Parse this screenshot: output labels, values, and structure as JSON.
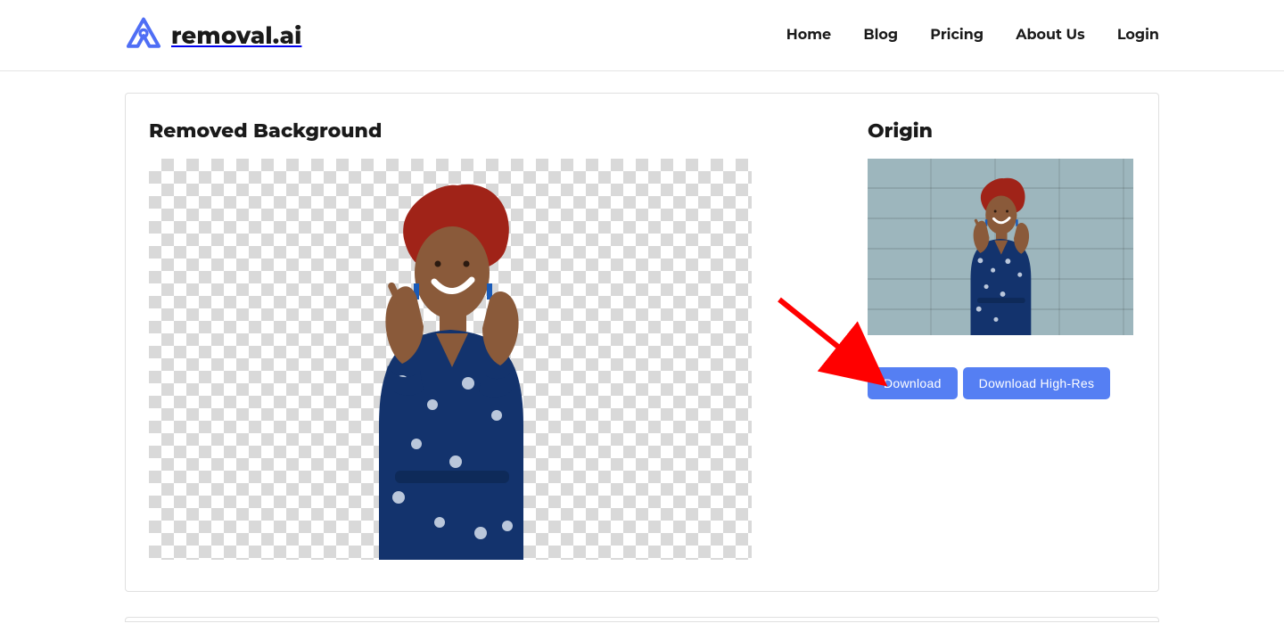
{
  "brand": {
    "name": "removal.ai",
    "accent": "#4f6ef5"
  },
  "nav": {
    "home": "Home",
    "blog": "Blog",
    "pricing": "Pricing",
    "about": "About Us",
    "login": "Login"
  },
  "result": {
    "heading": "Removed Background",
    "subject_alt": "person with red curly hair in blue paisley dress, background removed"
  },
  "origin": {
    "heading": "Origin",
    "subject_alt": "original photo of person with red curly hair against grey brick wall"
  },
  "buttons": {
    "download": "Download",
    "download_highres": "Download High-Res",
    "accent": "#557ff3"
  },
  "annotation": {
    "arrow_color": "#ff0000"
  }
}
